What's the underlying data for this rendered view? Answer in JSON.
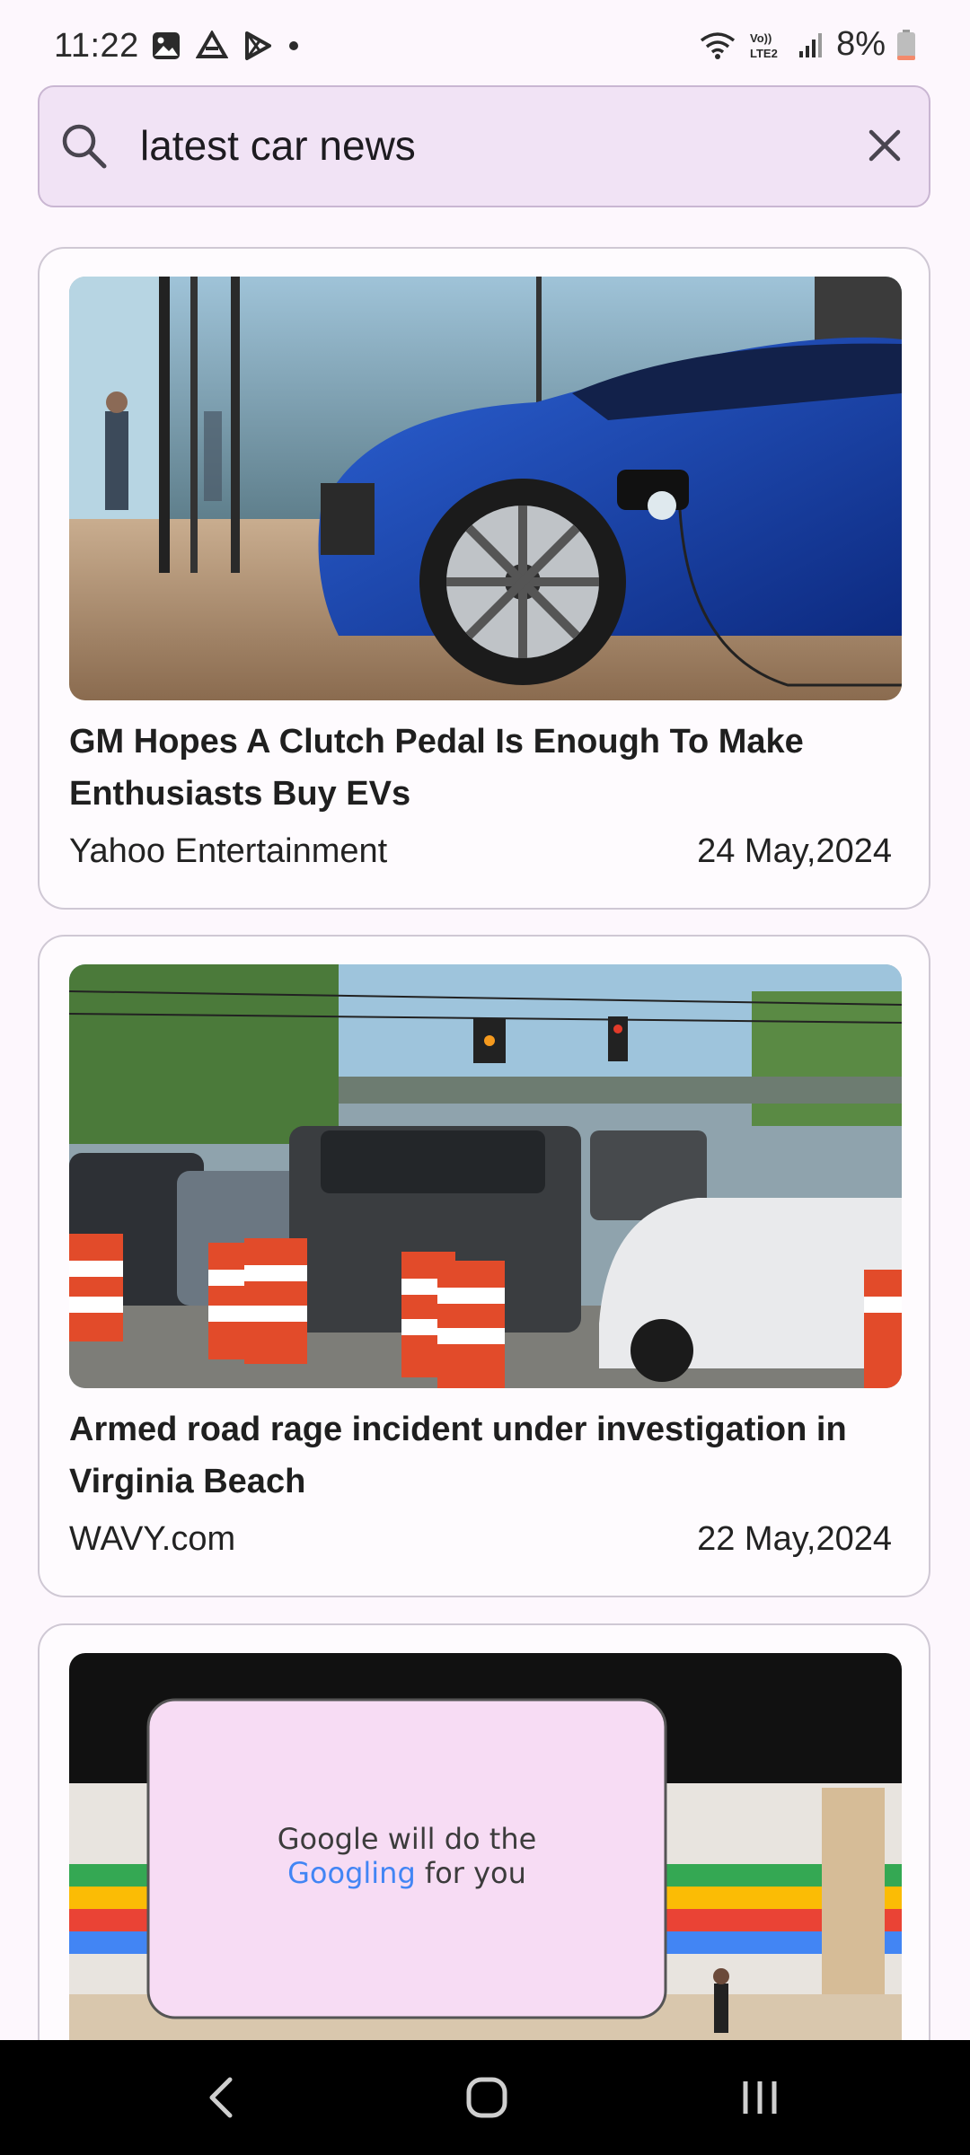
{
  "status": {
    "time": "11:22",
    "battery": "8%",
    "network_label": "Vo)) LTE2"
  },
  "search": {
    "query": "latest car news",
    "icon": "search-icon",
    "clear_icon": "close-icon"
  },
  "articles": [
    {
      "title": "GM Hopes A Clutch Pedal Is Enough To Make Enthusiasts Buy EVs",
      "source": "Yahoo Entertainment",
      "date": "24 May,2024"
    },
    {
      "title": "Armed road rage incident under investigation in Virginia Beach",
      "source": "WAVY.com",
      "date": "22 May,2024"
    },
    {
      "image_text_line1": "Google will do the",
      "image_text_line2_a": "Googling",
      "image_text_line2_b": " for you"
    }
  ],
  "nav": {
    "back_icon": "back-icon",
    "home_icon": "home-icon",
    "recents_icon": "recents-icon"
  },
  "colors": {
    "background": "#fdf7fd",
    "search_bg": "#f1e3f5",
    "card_border": "#cfc8d4",
    "google_blue": "#4285f4",
    "google_green": "#34a853"
  }
}
